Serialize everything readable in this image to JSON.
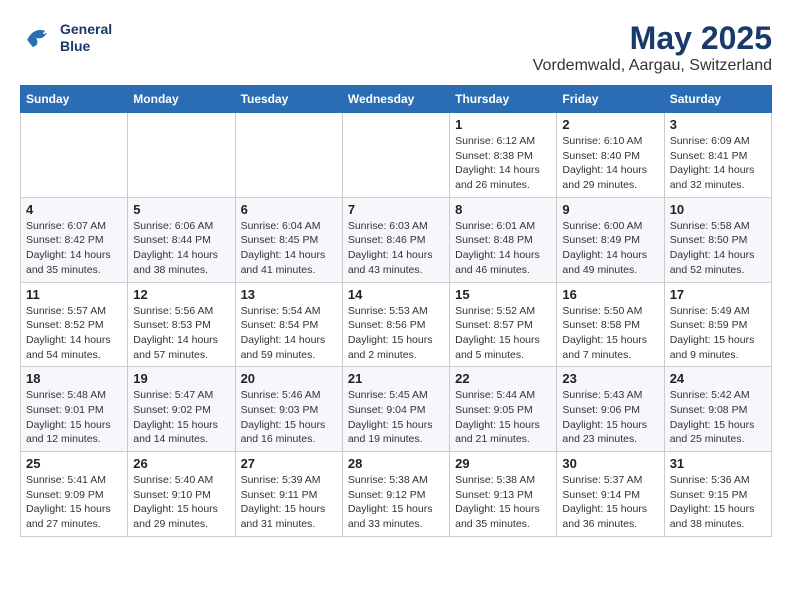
{
  "header": {
    "logo_line1": "General",
    "logo_line2": "Blue",
    "title": "May 2025",
    "subtitle": "Vordemwald, Aargau, Switzerland"
  },
  "weekdays": [
    "Sunday",
    "Monday",
    "Tuesday",
    "Wednesday",
    "Thursday",
    "Friday",
    "Saturday"
  ],
  "weeks": [
    [
      {
        "day": "",
        "info": ""
      },
      {
        "day": "",
        "info": ""
      },
      {
        "day": "",
        "info": ""
      },
      {
        "day": "",
        "info": ""
      },
      {
        "day": "1",
        "info": "Sunrise: 6:12 AM\nSunset: 8:38 PM\nDaylight: 14 hours and 26 minutes."
      },
      {
        "day": "2",
        "info": "Sunrise: 6:10 AM\nSunset: 8:40 PM\nDaylight: 14 hours and 29 minutes."
      },
      {
        "day": "3",
        "info": "Sunrise: 6:09 AM\nSunset: 8:41 PM\nDaylight: 14 hours and 32 minutes."
      }
    ],
    [
      {
        "day": "4",
        "info": "Sunrise: 6:07 AM\nSunset: 8:42 PM\nDaylight: 14 hours and 35 minutes."
      },
      {
        "day": "5",
        "info": "Sunrise: 6:06 AM\nSunset: 8:44 PM\nDaylight: 14 hours and 38 minutes."
      },
      {
        "day": "6",
        "info": "Sunrise: 6:04 AM\nSunset: 8:45 PM\nDaylight: 14 hours and 41 minutes."
      },
      {
        "day": "7",
        "info": "Sunrise: 6:03 AM\nSunset: 8:46 PM\nDaylight: 14 hours and 43 minutes."
      },
      {
        "day": "8",
        "info": "Sunrise: 6:01 AM\nSunset: 8:48 PM\nDaylight: 14 hours and 46 minutes."
      },
      {
        "day": "9",
        "info": "Sunrise: 6:00 AM\nSunset: 8:49 PM\nDaylight: 14 hours and 49 minutes."
      },
      {
        "day": "10",
        "info": "Sunrise: 5:58 AM\nSunset: 8:50 PM\nDaylight: 14 hours and 52 minutes."
      }
    ],
    [
      {
        "day": "11",
        "info": "Sunrise: 5:57 AM\nSunset: 8:52 PM\nDaylight: 14 hours and 54 minutes."
      },
      {
        "day": "12",
        "info": "Sunrise: 5:56 AM\nSunset: 8:53 PM\nDaylight: 14 hours and 57 minutes."
      },
      {
        "day": "13",
        "info": "Sunrise: 5:54 AM\nSunset: 8:54 PM\nDaylight: 14 hours and 59 minutes."
      },
      {
        "day": "14",
        "info": "Sunrise: 5:53 AM\nSunset: 8:56 PM\nDaylight: 15 hours and 2 minutes."
      },
      {
        "day": "15",
        "info": "Sunrise: 5:52 AM\nSunset: 8:57 PM\nDaylight: 15 hours and 5 minutes."
      },
      {
        "day": "16",
        "info": "Sunrise: 5:50 AM\nSunset: 8:58 PM\nDaylight: 15 hours and 7 minutes."
      },
      {
        "day": "17",
        "info": "Sunrise: 5:49 AM\nSunset: 8:59 PM\nDaylight: 15 hours and 9 minutes."
      }
    ],
    [
      {
        "day": "18",
        "info": "Sunrise: 5:48 AM\nSunset: 9:01 PM\nDaylight: 15 hours and 12 minutes."
      },
      {
        "day": "19",
        "info": "Sunrise: 5:47 AM\nSunset: 9:02 PM\nDaylight: 15 hours and 14 minutes."
      },
      {
        "day": "20",
        "info": "Sunrise: 5:46 AM\nSunset: 9:03 PM\nDaylight: 15 hours and 16 minutes."
      },
      {
        "day": "21",
        "info": "Sunrise: 5:45 AM\nSunset: 9:04 PM\nDaylight: 15 hours and 19 minutes."
      },
      {
        "day": "22",
        "info": "Sunrise: 5:44 AM\nSunset: 9:05 PM\nDaylight: 15 hours and 21 minutes."
      },
      {
        "day": "23",
        "info": "Sunrise: 5:43 AM\nSunset: 9:06 PM\nDaylight: 15 hours and 23 minutes."
      },
      {
        "day": "24",
        "info": "Sunrise: 5:42 AM\nSunset: 9:08 PM\nDaylight: 15 hours and 25 minutes."
      }
    ],
    [
      {
        "day": "25",
        "info": "Sunrise: 5:41 AM\nSunset: 9:09 PM\nDaylight: 15 hours and 27 minutes."
      },
      {
        "day": "26",
        "info": "Sunrise: 5:40 AM\nSunset: 9:10 PM\nDaylight: 15 hours and 29 minutes."
      },
      {
        "day": "27",
        "info": "Sunrise: 5:39 AM\nSunset: 9:11 PM\nDaylight: 15 hours and 31 minutes."
      },
      {
        "day": "28",
        "info": "Sunrise: 5:38 AM\nSunset: 9:12 PM\nDaylight: 15 hours and 33 minutes."
      },
      {
        "day": "29",
        "info": "Sunrise: 5:38 AM\nSunset: 9:13 PM\nDaylight: 15 hours and 35 minutes."
      },
      {
        "day": "30",
        "info": "Sunrise: 5:37 AM\nSunset: 9:14 PM\nDaylight: 15 hours and 36 minutes."
      },
      {
        "day": "31",
        "info": "Sunrise: 5:36 AM\nSunset: 9:15 PM\nDaylight: 15 hours and 38 minutes."
      }
    ]
  ]
}
